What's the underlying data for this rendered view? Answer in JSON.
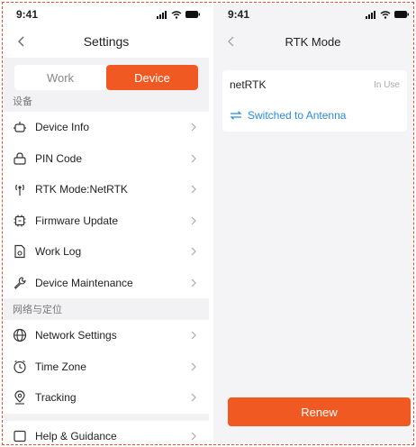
{
  "settings": {
    "status_time": "9:41",
    "title": "Settings",
    "tabs": [
      "Work",
      "Device"
    ],
    "active_tab": "Device",
    "section_device": "设备",
    "device_items": [
      {
        "label": "Device Info",
        "icon": "device-info-icon"
      },
      {
        "label": "PIN Code",
        "icon": "lock-icon"
      },
      {
        "label": "RTK Mode:NetRTK",
        "icon": "antenna-icon"
      },
      {
        "label": "Firmware Update",
        "icon": "chip-icon"
      },
      {
        "label": "Work Log",
        "icon": "document-icon"
      },
      {
        "label": "Device Maintenance",
        "icon": "wrench-icon"
      }
    ],
    "section_network": "网络与定位",
    "network_items": [
      {
        "label": "Network Settings",
        "icon": "globe-icon"
      },
      {
        "label": "Time Zone",
        "icon": "clock-icon"
      },
      {
        "label": "Tracking",
        "icon": "location-pin-icon"
      }
    ],
    "more_items": [
      {
        "label": "Help & Guidance",
        "icon": "help-icon"
      }
    ]
  },
  "rtk": {
    "status_time": "9:41",
    "title": "RTK Mode",
    "mode_name": "netRTK",
    "mode_status": "In Use",
    "switch_label": "Switched to Antenna",
    "renew_label": "Renew"
  },
  "colors": {
    "accent": "#f05a22",
    "link": "#2e8bd8",
    "border": "#e3502a"
  }
}
